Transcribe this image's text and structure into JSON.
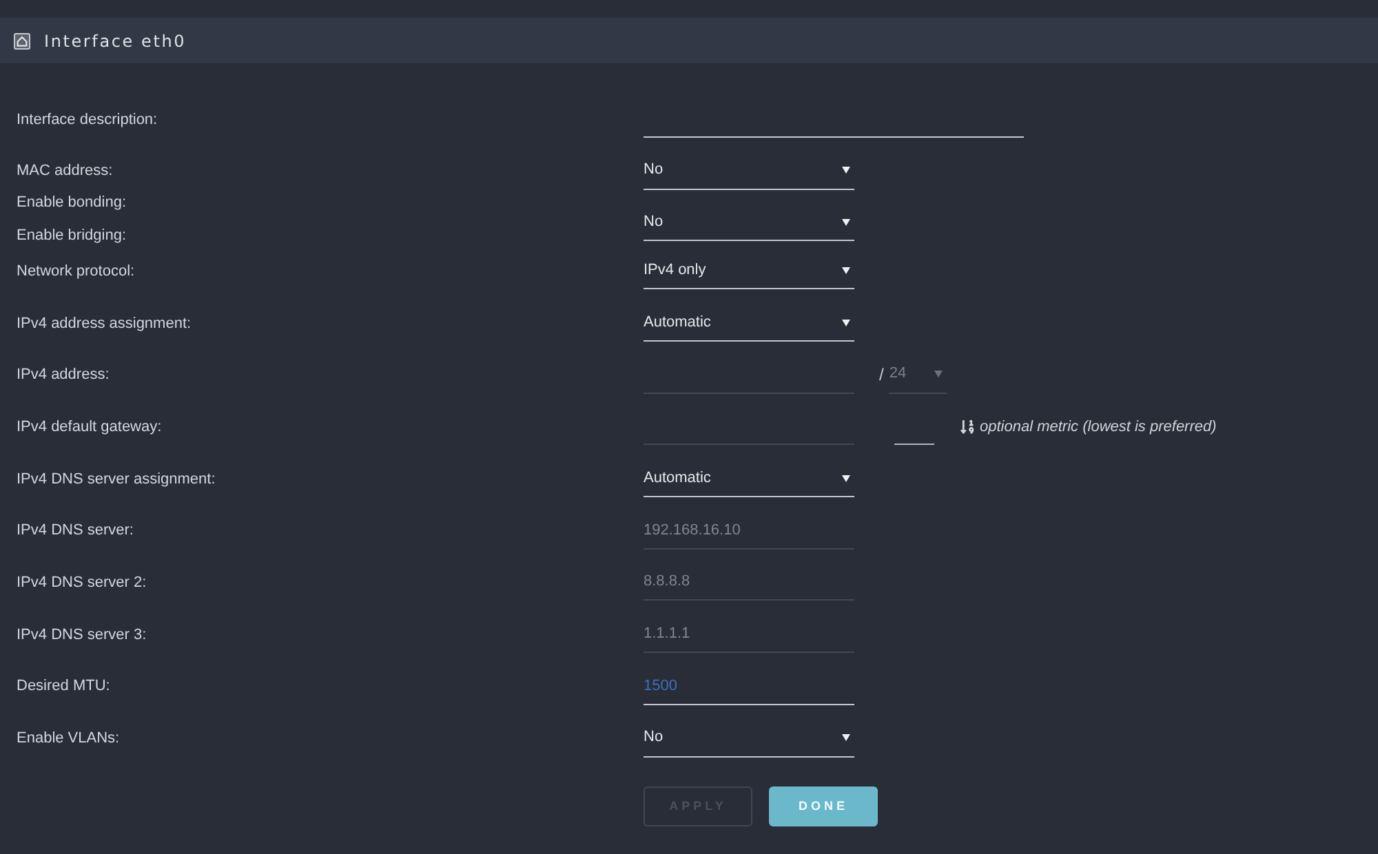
{
  "panel": {
    "title": "Interface eth0"
  },
  "rows": [
    {
      "kind": "wide_text",
      "label": "Interface description:",
      "input": {
        "disabled": false
      }
    },
    {
      "kind": "select",
      "label": "MAC address:",
      "select": {
        "value": "No"
      }
    },
    {
      "kind": "select_group",
      "labels": [
        "Enable bonding:",
        "Enable bridging:"
      ],
      "select": {
        "value": "No"
      }
    },
    {
      "kind": "select",
      "label": "Network protocol:",
      "select": {
        "value": "IPv4 only"
      }
    },
    {
      "kind": "select",
      "label": "IPv4 address assignment:",
      "select": {
        "value": "Automatic"
      }
    },
    {
      "kind": "address",
      "label": "IPv4 address:",
      "input": {
        "disabled": true
      },
      "separator": "/",
      "prefix": {
        "value": "24",
        "disabled": true
      }
    },
    {
      "kind": "gateway",
      "label": "IPv4 default gateway:",
      "input": {
        "disabled": true
      },
      "metric": {
        "disabled": false
      },
      "hint": "optional metric (lowest is preferred)"
    },
    {
      "kind": "select",
      "label": "IPv4 DNS server assignment:",
      "select": {
        "value": "Automatic"
      }
    },
    {
      "kind": "text",
      "label": "IPv4 DNS server:",
      "input": {
        "value": "192.168.16.10",
        "disabled": true,
        "modified": false
      }
    },
    {
      "kind": "text",
      "label": "IPv4 DNS server 2:",
      "input": {
        "value": "8.8.8.8",
        "disabled": true,
        "modified": false
      }
    },
    {
      "kind": "text",
      "label": "IPv4 DNS server 3:",
      "input": {
        "value": "1.1.1.1",
        "disabled": true,
        "modified": false
      }
    },
    {
      "kind": "text",
      "label": "Desired MTU:",
      "input": {
        "value": "1500",
        "disabled": false,
        "modified": true
      }
    },
    {
      "kind": "select",
      "label": "Enable VLANs:",
      "select": {
        "value": "No"
      }
    }
  ],
  "buttons": [
    {
      "label": "APPLY",
      "kind": "secondary",
      "disabled": true
    },
    {
      "label": "DONE",
      "kind": "primary",
      "disabled": false
    }
  ]
}
